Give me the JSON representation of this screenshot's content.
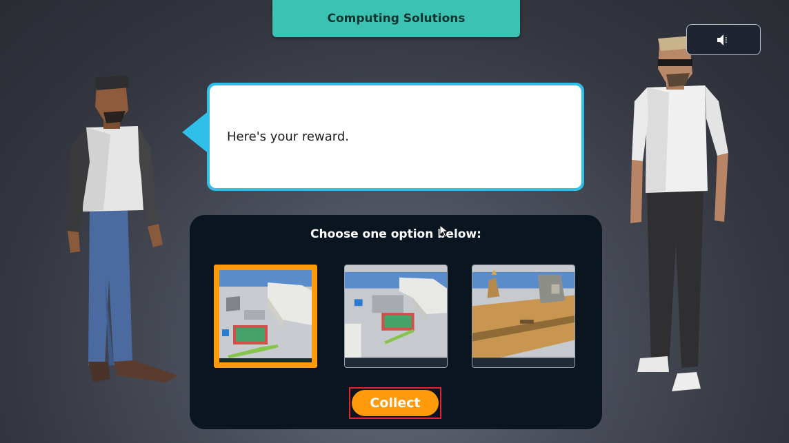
{
  "header": {
    "title": "Computing Solutions"
  },
  "sound": {
    "icon": "speaker-icon"
  },
  "dialog": {
    "text": "Here's your reward."
  },
  "panel": {
    "prompt": "Choose one option below:",
    "options": [
      {
        "name": "city-block-with-basketball-court-and-offices",
        "selected": true
      },
      {
        "name": "city-block-with-parking-and-basketball-court",
        "selected": false
      },
      {
        "name": "historic-district-with-plaza",
        "selected": false
      }
    ],
    "collect_label": "Collect"
  },
  "colors": {
    "accent": "#ff9a0a",
    "banner": "#3cc2b2",
    "bubble_border": "#2fbfe8",
    "panel_bg": "#0b1520"
  }
}
